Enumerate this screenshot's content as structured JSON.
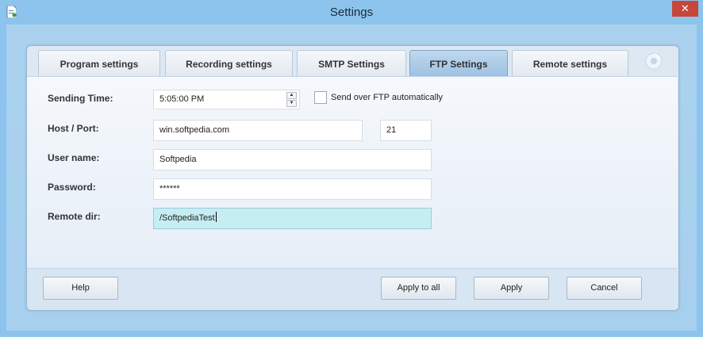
{
  "window": {
    "title": "Settings",
    "close_glyph": "✕",
    "app_icon": "document-icon"
  },
  "tabs": [
    {
      "label": "Program settings",
      "active": false
    },
    {
      "label": "Recording settings",
      "active": false
    },
    {
      "label": "SMTP Settings",
      "active": false
    },
    {
      "label": "FTP Settings",
      "active": true
    },
    {
      "label": "Remote settings",
      "active": false
    }
  ],
  "ftp": {
    "sending_time_label": "Sending Time:",
    "sending_time_value": "5:05:00 PM",
    "send_auto_label": "Send over FTP automatically",
    "send_auto_checked": false,
    "host_port_label": "Host / Port:",
    "host_value": "win.softpedia.com",
    "port_value": "21",
    "username_label": "User name:",
    "username_value": "Softpedia",
    "password_label": "Password:",
    "password_value": "******",
    "remote_dir_label": "Remote dir:",
    "remote_dir_value": "/SoftpediaTest"
  },
  "buttons": {
    "help": "Help",
    "apply_to_all": "Apply to all",
    "apply": "Apply",
    "cancel": "Cancel"
  },
  "colors": {
    "accent": "#9fc1e2",
    "active_field": "#c5edf2",
    "close": "#c7463a"
  }
}
